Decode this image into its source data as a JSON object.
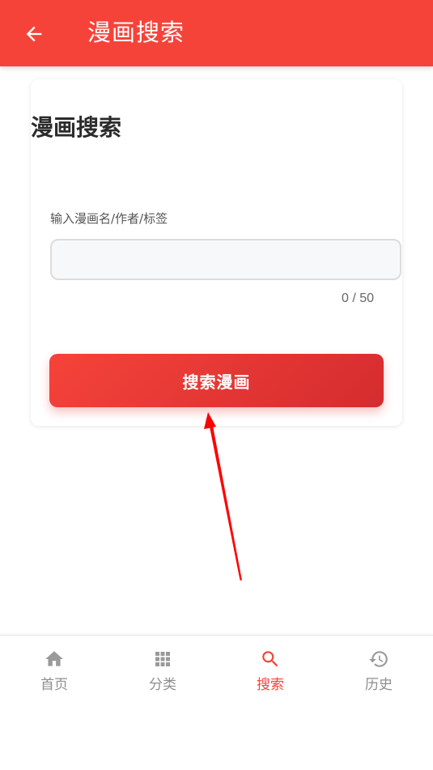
{
  "appbar": {
    "title": "漫画搜索",
    "back_icon": "arrow-left-icon"
  },
  "card": {
    "title": "漫画搜索",
    "field_label": "输入漫画名/作者/标签",
    "input_value": "",
    "input_placeholder": "",
    "counter": "0 / 50",
    "button_label": "搜索漫画"
  },
  "bottom_nav": {
    "items": [
      {
        "label": "首页",
        "icon": "home-icon",
        "active": false
      },
      {
        "label": "分类",
        "icon": "grid-icon",
        "active": false
      },
      {
        "label": "搜索",
        "icon": "search-icon",
        "active": true
      },
      {
        "label": "历史",
        "icon": "history-icon",
        "active": false
      }
    ]
  },
  "colors": {
    "primary": "#f5433a",
    "nav_inactive": "#8e8e8e",
    "annotation_arrow": "#ff0000"
  }
}
